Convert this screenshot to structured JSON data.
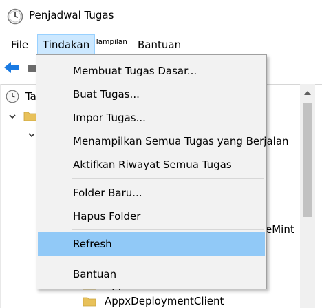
{
  "window": {
    "title": "Penjadwal Tugas"
  },
  "menubar": {
    "items": [
      {
        "label": "File"
      },
      {
        "label": "Tindakan"
      },
      {
        "label": "Tampilan"
      },
      {
        "label": "Bantuan"
      }
    ]
  },
  "action_menu": {
    "items": [
      {
        "label": "Membuat Tugas Dasar..."
      },
      {
        "label": "Buat Tugas..."
      },
      {
        "label": "Impor Tugas..."
      },
      {
        "label": "Menampilkan Semua Tugas yang Berjalan"
      },
      {
        "label": "Aktifkan Riwayat Semua Tugas"
      },
      {
        "label": "Folder Baru..."
      },
      {
        "label": "Hapus Folder"
      },
      {
        "label": "Refresh"
      },
      {
        "label": "Bantuan"
      }
    ],
    "highlighted": "Refresh"
  },
  "tree": {
    "root_label": "Ta",
    "partial_label_fragment": "eMint",
    "items": [
      {
        "label": "ApplicationData"
      },
      {
        "label": "AppxDeploymentClient"
      }
    ]
  },
  "colors": {
    "menu_highlight": "#91c9f7",
    "menubar_active": "#cce8ff",
    "back_arrow": "#1a7ae2",
    "folder": "#e8c15a"
  },
  "icons": {
    "title": "task-scheduler-clock-icon",
    "back": "back-arrow-icon",
    "root": "task-scheduler-clock-icon",
    "folder": "folder-icon"
  }
}
